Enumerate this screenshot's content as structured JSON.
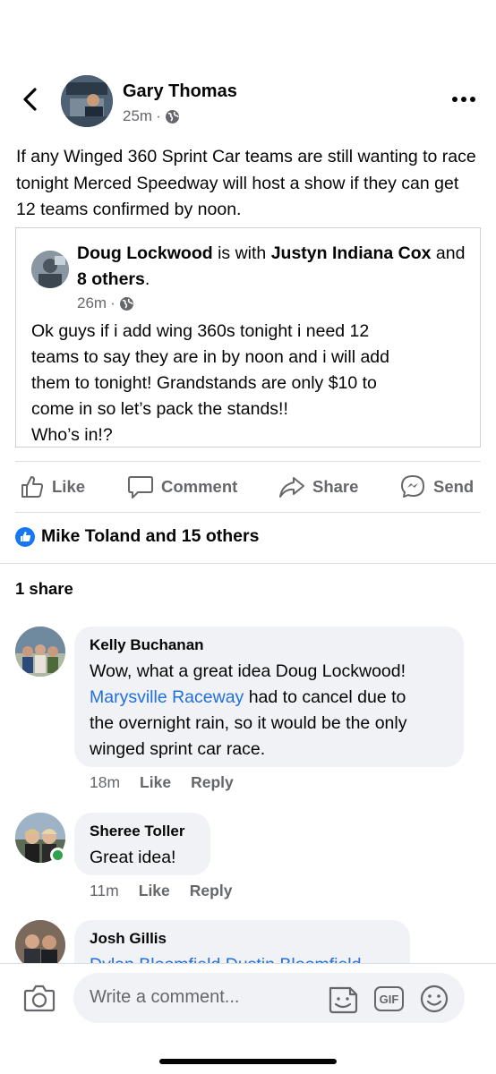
{
  "post": {
    "author": "Gary Thomas",
    "time": "25m",
    "dot": "·",
    "text": "If any Winged 360 Sprint Car teams are still wanting to race tonight Merced Speedway will host a show if they can get 12 teams confirmed by noon."
  },
  "shared_post": {
    "author": "Doug Lockwood",
    "is_with": "is with",
    "tagged": "Justyn Indiana Cox",
    "and": "and",
    "others": "8 others",
    "period": ".",
    "time": "26m",
    "dot": "·",
    "text_lines": [
      "Ok guys if i add wing 360s tonight i need 12",
      "teams to say they are in by noon and i will add",
      "them to tonight! Grandstands are only $10 to",
      "come in so let’s pack the stands!!",
      "Who’s in!?"
    ]
  },
  "actions": {
    "like": "Like",
    "comment": "Comment",
    "share": "Share",
    "send": "Send"
  },
  "reactions": {
    "summary": "Mike Toland and 15 others"
  },
  "shares": {
    "count_text": "1 share"
  },
  "comments": [
    {
      "name": "Kelly Buchanan",
      "line1": "Wow, what a great idea Doug Lockwood!",
      "link": "Marysville Raceway",
      "line2_rest": " had to cancel due to",
      "line3": "the overnight rain, so it would be the only",
      "line4": "winged sprint car race.",
      "time": "18m",
      "like": "Like",
      "reply": "Reply"
    },
    {
      "name": "Sheree Toller",
      "text": "Great idea!",
      "time": "11m",
      "like": "Like",
      "reply": "Reply"
    },
    {
      "name": "Josh Gillis",
      "text": "Dylan Bloomfield Dustin Bloomfield"
    }
  ],
  "composer": {
    "placeholder": "Write a comment...",
    "gif": "GIF"
  },
  "icons": {
    "back": "chevron-left-icon",
    "more": "more-horizontal-icon",
    "privacy": "globe-icon",
    "like": "thumbs-up-icon",
    "comment": "speech-bubble-icon",
    "share": "share-arrow-icon",
    "send": "messenger-icon",
    "camera": "camera-icon",
    "sticker": "sticker-icon",
    "gif": "gif-icon",
    "emoji": "emoji-icon"
  },
  "colors": {
    "link": "#216fdb",
    "like_blue": "#1877f2",
    "secondary_text": "#65676b",
    "bubble": "#f0f2f5",
    "online": "#31a24c"
  }
}
